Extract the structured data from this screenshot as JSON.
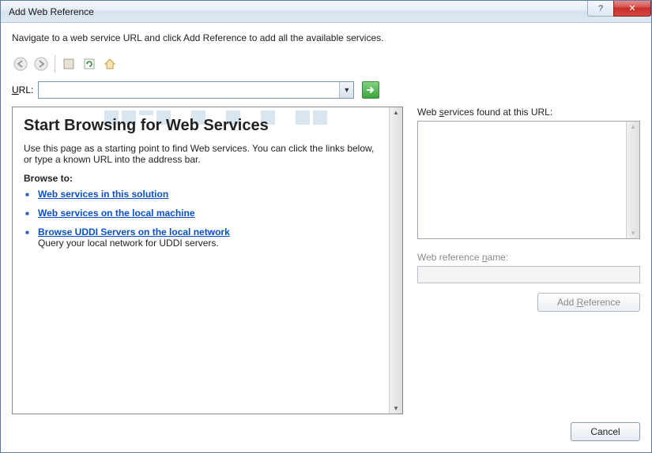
{
  "window": {
    "title": "Add Web Reference"
  },
  "instruction": "Navigate to a web service URL and click Add Reference to add all the available services.",
  "url": {
    "label_html": "URL:",
    "value": ""
  },
  "browser": {
    "heading": "Start Browsing for Web Services",
    "intro": "Use this page as a starting point to find Web services. You can click the links below, or type a known URL into the address bar.",
    "browse_label": "Browse to:",
    "links": [
      {
        "text": "Web services in this solution",
        "desc": ""
      },
      {
        "text": "Web services on the local machine",
        "desc": ""
      },
      {
        "text": "Browse UDDI Servers on the local network",
        "desc": "Query your local network for UDDI servers."
      }
    ]
  },
  "right": {
    "services_label": "Web services found at this URL:",
    "refname_label": "Web reference name:",
    "refname_value": "",
    "add_reference": "Add Reference"
  },
  "buttons": {
    "cancel": "Cancel",
    "help": "?",
    "close": "✕"
  }
}
